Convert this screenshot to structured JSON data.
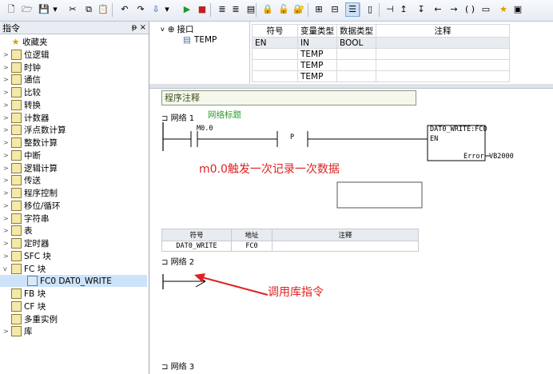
{
  "toolbar": {
    "icons": [
      "new-icon",
      "open-icon",
      "save-icon",
      "save-dropdown-icon",
      "cut-icon",
      "copy-icon",
      "paste-icon",
      "undo-icon",
      "redo-icon",
      "download-icon",
      "download-dropdown-icon",
      "run-icon",
      "stop-icon",
      "compile-icon",
      "compile-all-icon",
      "network-icon",
      "lock-icon",
      "unlock-icon",
      "lock-blue-icon",
      "insert-network-icon",
      "delete-network-icon",
      "ladder-view-icon",
      "stl-view-icon",
      "contact-icon",
      "branch-up-icon",
      "branch-down-icon",
      "line-left-icon",
      "line-right-icon",
      "coil-icon",
      "box-icon",
      "star-icon",
      "bookmark-icon"
    ]
  },
  "left_panel": {
    "title": "指令",
    "pin": "ᵽ ×",
    "items": [
      {
        "label": "收藏夹",
        "icon": "star-icon",
        "expand": ""
      },
      {
        "label": "位逻辑",
        "icon": "folder-icon",
        "expand": ">"
      },
      {
        "label": "时钟",
        "icon": "folder-icon",
        "expand": ">"
      },
      {
        "label": "通信",
        "icon": "folder-icon",
        "expand": ">"
      },
      {
        "label": "比较",
        "icon": "folder-icon",
        "expand": ">"
      },
      {
        "label": "转换",
        "icon": "folder-icon",
        "expand": ">"
      },
      {
        "label": "计数器",
        "icon": "folder-icon",
        "expand": ">"
      },
      {
        "label": "浮点数计算",
        "icon": "folder-icon",
        "expand": ">"
      },
      {
        "label": "整数计算",
        "icon": "folder-icon",
        "expand": ">"
      },
      {
        "label": "中断",
        "icon": "folder-icon",
        "expand": ">"
      },
      {
        "label": "逻辑计算",
        "icon": "folder-icon",
        "expand": ">"
      },
      {
        "label": "传送",
        "icon": "folder-icon",
        "expand": ">"
      },
      {
        "label": "程序控制",
        "icon": "folder-icon",
        "expand": ">"
      },
      {
        "label": "移位/循环",
        "icon": "folder-icon",
        "expand": ">"
      },
      {
        "label": "字符串",
        "icon": "folder-icon",
        "expand": ">"
      },
      {
        "label": "表",
        "icon": "folder-icon",
        "expand": ">"
      },
      {
        "label": "定时器",
        "icon": "folder-icon",
        "expand": ">"
      },
      {
        "label": "SFC 块",
        "icon": "folder-icon",
        "expand": ">"
      },
      {
        "label": "FC 块",
        "icon": "folder-icon",
        "expand": "v"
      },
      {
        "label": "FC0 DAT0_WRITE",
        "icon": "block-icon",
        "expand": "",
        "child": true
      },
      {
        "label": "FB 块",
        "icon": "folder-icon",
        "expand": ""
      },
      {
        "label": "CF 块",
        "icon": "folder-icon",
        "expand": ""
      },
      {
        "label": "多重实例",
        "icon": "folder-icon",
        "expand": ""
      },
      {
        "label": "库",
        "icon": "folder-icon",
        "expand": ">"
      }
    ]
  },
  "interface": {
    "root": "接口",
    "child": "TEMP",
    "headers": [
      "符号",
      "变量类型",
      "数据类型",
      "注释"
    ],
    "rows": [
      [
        "EN",
        "IN",
        "BOOL",
        ""
      ],
      [
        "",
        "TEMP",
        "",
        ""
      ],
      [
        "",
        "TEMP",
        "",
        ""
      ],
      [
        "",
        "TEMP",
        "",
        ""
      ]
    ]
  },
  "program": {
    "comment_label": "程序注释",
    "network1": {
      "label": "网络 1",
      "title": "网络标题",
      "contact1": "M0.0",
      "contact2": "P",
      "block_name": "DAT0_WRITE:FC0",
      "block_en": "EN",
      "block_out_label": "Error",
      "block_out_value": "VB2000",
      "annotation": "m0.0触发一次记录一次数据"
    },
    "symbol_table": {
      "headers": [
        "符号",
        "地址",
        "注释"
      ],
      "row": [
        "DAT0_WRITE",
        "FC0",
        ""
      ]
    },
    "network2": {
      "label": "网络 2"
    },
    "network3": {
      "label": "网络 3"
    }
  },
  "callout": {
    "text": "调用库指令",
    "color": "#e02020"
  },
  "colors": {
    "annotation": "#e02020",
    "network_title": "#2e9a2e",
    "selection": "#cde3fa"
  }
}
